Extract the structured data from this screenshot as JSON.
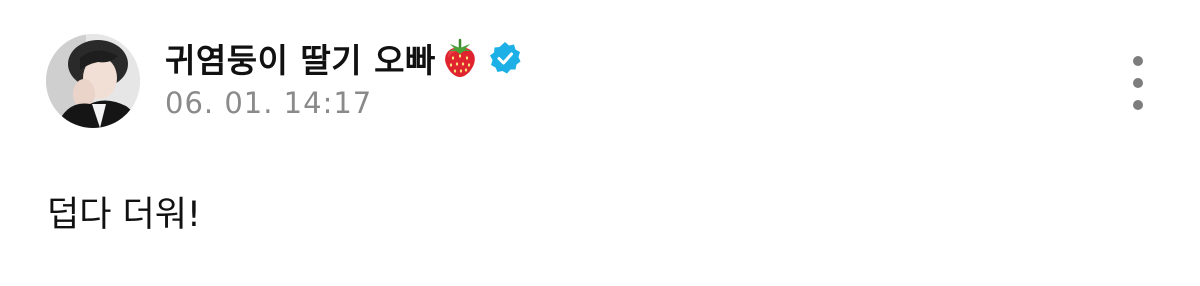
{
  "post": {
    "author": {
      "name": "귀염둥이 딸기 오빠",
      "name_emoji": "strawberry-emoji",
      "verified_icon": "verified-badge-icon",
      "verified_color": "#1db0e6",
      "avatar": "avatar"
    },
    "timestamp": "06. 01. 14:17",
    "body": "덥다 더워!",
    "menu_icon": "more-vertical-icon"
  }
}
